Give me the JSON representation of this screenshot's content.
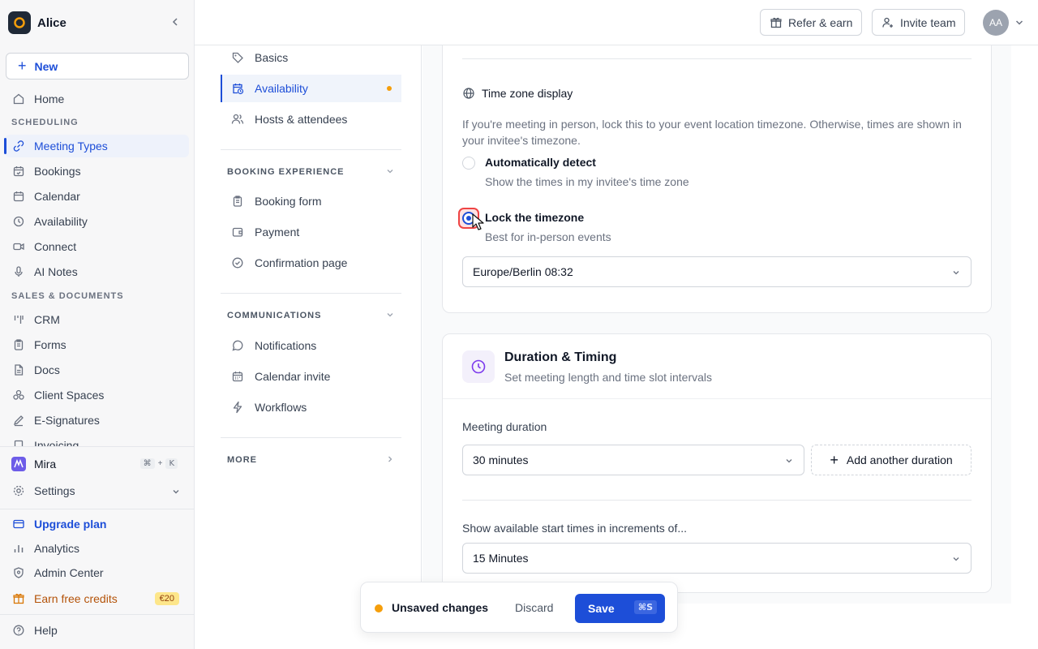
{
  "workspace": {
    "name": "Alice"
  },
  "sidebar": {
    "new_label": "New",
    "home": "Home",
    "scheduling_label": "SCHEDULING",
    "scheduling_items": [
      "Meeting Types",
      "Bookings",
      "Calendar",
      "Availability",
      "Connect",
      "AI Notes"
    ],
    "sales_label": "SALES & DOCUMENTS",
    "sales_items": [
      "CRM",
      "Forms",
      "Docs",
      "Client Spaces",
      "E-Signatures",
      "Invoicing"
    ],
    "mira": "Mira",
    "mira_kbd": [
      "⌘",
      "+",
      "K"
    ],
    "settings": "Settings",
    "upgrade": "Upgrade plan",
    "analytics": "Analytics",
    "admin": "Admin Center",
    "earn": "Earn free credits",
    "earn_badge": "€20",
    "help": "Help"
  },
  "topbar": {
    "refer": "Refer & earn",
    "invite": "Invite team",
    "avatar_initials": "AA"
  },
  "settings_nav": {
    "items_top": [
      "Basics",
      "Availability",
      "Hosts & attendees"
    ],
    "booking_label": "BOOKING EXPERIENCE",
    "booking_items": [
      "Booking form",
      "Payment",
      "Confirmation page"
    ],
    "comm_label": "COMMUNICATIONS",
    "comm_items": [
      "Notifications",
      "Calendar invite",
      "Workflows"
    ],
    "more_label": "MORE"
  },
  "timezone": {
    "title": "Time zone display",
    "description": "If you're meeting in person, lock this to your event location timezone. Otherwise, times are shown in your invitee's timezone.",
    "option_auto": {
      "label": "Automatically detect",
      "sub": "Show the times in my invitee's time zone"
    },
    "option_lock": {
      "label": "Lock the timezone",
      "sub": "Best for in-person events"
    },
    "selected": "lock",
    "select_value": "Europe/Berlin 08:32"
  },
  "duration": {
    "title": "Duration & Timing",
    "subtitle": "Set meeting length and time slot intervals",
    "meeting_duration_label": "Meeting duration",
    "meeting_duration_value": "30 minutes",
    "add_another": "Add another duration",
    "increments_label": "Show available start times in increments of...",
    "increments_value": "15 Minutes"
  },
  "unsaved": {
    "text": "Unsaved changes",
    "discard": "Discard",
    "save": "Save",
    "save_kbd": "⌘S"
  },
  "colors": {
    "accent": "#1d4ed8",
    "warning_dot": "#f59e0b",
    "focus_ring": "#ef4444"
  }
}
